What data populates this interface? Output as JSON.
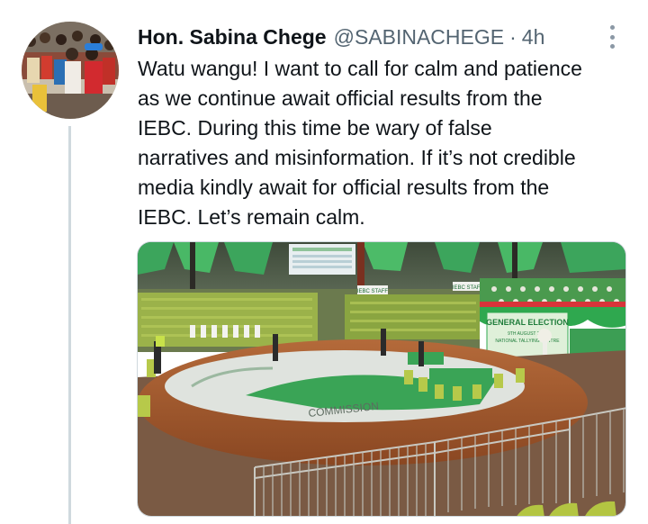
{
  "tweet": {
    "author_name": "Hon. Sabina Chege",
    "author_handle": "@SABINACHEGE",
    "separator": "·",
    "timestamp": "4h",
    "text_lines": [
      "Watu wangu! I want to call for calm and patience",
      "as we continue await official results from the",
      "IEBC. During this time be wary of false",
      "narratives and misinformation. If it’s not credible",
      "media kindly await for official results from the",
      "IEBC. Let’s remain calm."
    ],
    "media": {
      "banner_title": "GENERAL ELECTION",
      "banner_subtitle": "9TH AUGUST 2022",
      "banner_subtitle2": "NATIONAL TALLYING CENTRE",
      "floor_text": "COMMISSION",
      "sign_left": "IEBC STAFF",
      "sign_right": "IEBC STAFF"
    }
  },
  "colors": {
    "name": "#0f1419",
    "secondary": "#536471",
    "thread_line": "#cfd9de",
    "iebc_green": "#2fa84f"
  },
  "icons": {
    "more": "more-vertical-icon"
  }
}
